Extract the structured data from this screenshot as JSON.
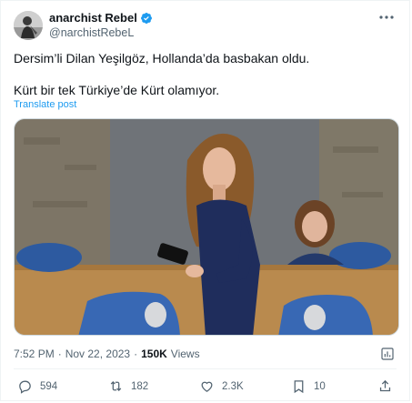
{
  "tweet": {
    "author_name": "anarchist Rebel",
    "author_handle": "@narchistRebeL",
    "text_line1": "Dersim’li Dilan Yeşilgöz, Hollanda’da basbakan oldu.",
    "text_line2": "Kürt bir tek Türkiye’de Kürt olamıyor.",
    "translate_label": "Translate post",
    "time": "7:52 PM",
    "separator": "·",
    "date": "Nov 22, 2023",
    "views_count": "150K",
    "views_label": "Views"
  },
  "actions": {
    "replies": "594",
    "reposts": "182",
    "likes": "2.3K",
    "bookmarks": "10"
  },
  "icons": {
    "verified": "verified-badge-icon",
    "more": "more-icon",
    "analytics": "analytics-icon",
    "reply": "reply-icon",
    "repost": "repost-icon",
    "like": "like-icon",
    "bookmark": "bookmark-icon",
    "share": "share-icon"
  },
  "colors": {
    "accent": "#1d9bf0",
    "secondary_text": "#536471",
    "primary_text": "#0f1419"
  }
}
